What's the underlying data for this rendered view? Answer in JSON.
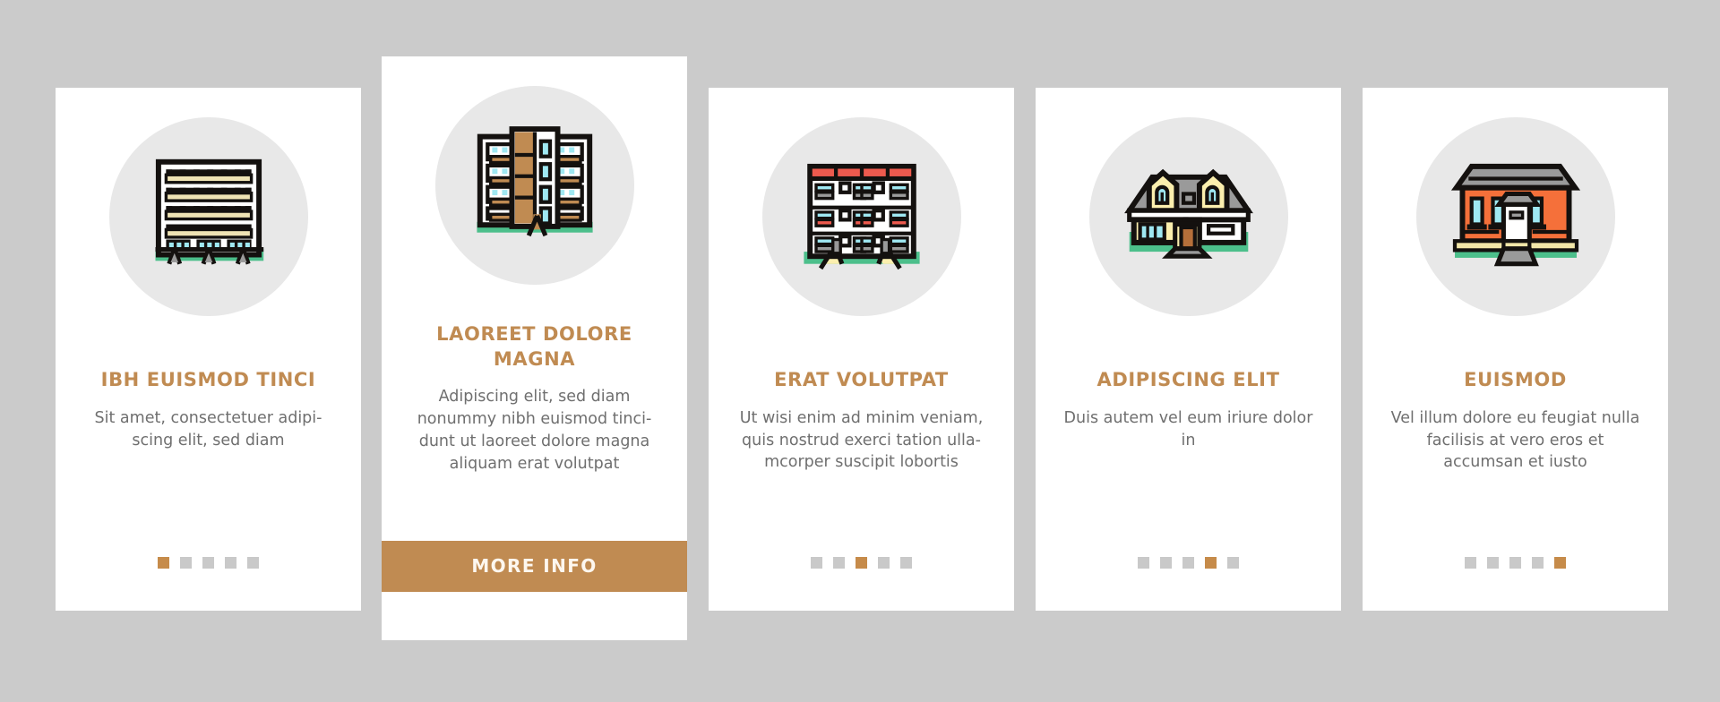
{
  "page": {
    "background_color": "#cbcbcb",
    "accent_color": "#c08b52",
    "title_color": "#c08b52",
    "body_text_color": "#6f6f6f",
    "card_background": "#ffffff",
    "icon_circle_color": "#e8e8e8",
    "dot_inactive_color": "#c9c9c9",
    "dot_active_color": "#c68b4a"
  },
  "cards": [
    {
      "id": "card-1",
      "featured": false,
      "icon_name": "apartment-block-balconies-icon",
      "title": "IBH EUISMOD TINCI",
      "description": "Sit amet, consectetuer adipi-scing elit, sed diam",
      "dots": {
        "count": 5,
        "active_index": 0
      },
      "button": null
    },
    {
      "id": "card-2",
      "featured": true,
      "icon_name": "twin-tower-residential-icon",
      "title": "LAOREET DOLORE MAGNA",
      "description": "Adipiscing elit, sed diam nonummy nibh euismod tinci-dunt ut laoreet dolore magna aliquam erat volutpat",
      "dots": null,
      "button": {
        "label": "MORE INFO",
        "name": "more-info-button"
      }
    },
    {
      "id": "card-3",
      "featured": false,
      "icon_name": "apartment-building-red-roof-icon",
      "title": "ERAT VOLUTPAT",
      "description": "Ut wisi enim ad minim veniam, quis nostrud exerci tation ulla-mcorper suscipit lobortis",
      "dots": {
        "count": 5,
        "active_index": 2
      },
      "button": null
    },
    {
      "id": "card-4",
      "featured": false,
      "icon_name": "suburban-house-dormers-icon",
      "title": "ADIPISCING ELIT",
      "description": "Duis autem vel eum iriure dolor in",
      "dots": {
        "count": 5,
        "active_index": 3
      },
      "button": null
    },
    {
      "id": "card-5",
      "featured": false,
      "icon_name": "orange-brick-house-icon",
      "title": "EUISMOD",
      "description": "Vel illum dolore eu feugiat nulla facilisis at vero eros et accumsan et iusto",
      "dots": {
        "count": 5,
        "active_index": 4
      },
      "button": null
    }
  ]
}
